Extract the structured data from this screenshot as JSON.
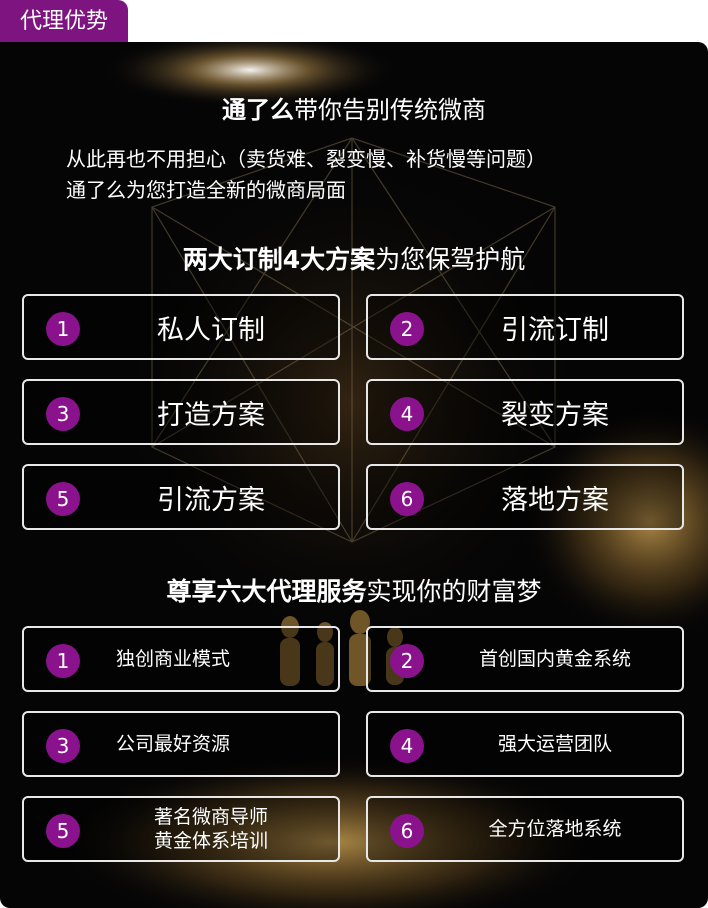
{
  "tab": "代理优势",
  "heading1": {
    "bold": "通了么",
    "rest": "带你告别传统微商"
  },
  "intro": [
    "从此再也不用担心（卖货难、裂变慢、补货慢等问题）",
    "通了么为您打造全新的微商局面"
  ],
  "heading2": {
    "bold": "两大订制4大方案",
    "rest": "为您保驾护航"
  },
  "plans": [
    {
      "num": "1",
      "label": "私人订制"
    },
    {
      "num": "2",
      "label": "引流订制"
    },
    {
      "num": "3",
      "label": "打造方案"
    },
    {
      "num": "4",
      "label": "裂变方案"
    },
    {
      "num": "5",
      "label": "引流方案"
    },
    {
      "num": "6",
      "label": "落地方案"
    }
  ],
  "heading3": {
    "bold": "尊享六大代理服务",
    "rest": "实现你的财富梦"
  },
  "services": [
    {
      "num": "1",
      "line1": "独创商业模式",
      "line2": ""
    },
    {
      "num": "2",
      "line1": "首创国内黄金系统",
      "line2": ""
    },
    {
      "num": "3",
      "line1": "公司最好资源",
      "line2": ""
    },
    {
      "num": "4",
      "line1": "强大运营团队",
      "line2": ""
    },
    {
      "num": "5",
      "line1": "著名微商导师",
      "line2": "黄金体系培训"
    },
    {
      "num": "6",
      "line1": "全方位落地系统",
      "line2": ""
    }
  ],
  "colors": {
    "accent": "#7d1480",
    "badge": "#8a138d",
    "background": "#050506",
    "card_border": "#e8e8e8",
    "gold": "#c9a24a"
  }
}
